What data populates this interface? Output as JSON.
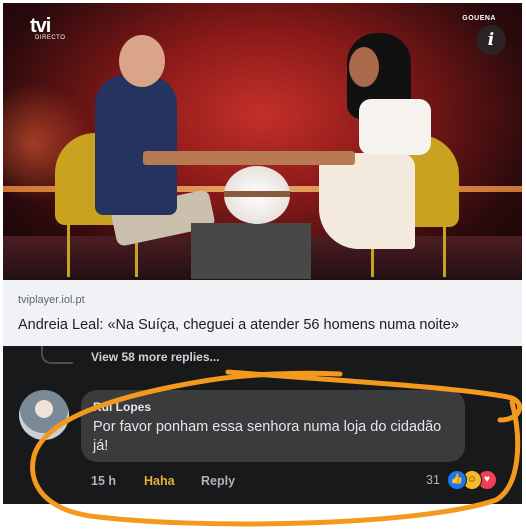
{
  "video": {
    "channel_logo": "tvi",
    "channel_logo_sub": "DIRECTO",
    "corner_label": "GOUENA",
    "info_icon": "info-icon"
  },
  "link_preview": {
    "source": "tviplayer.iol.pt",
    "headline": "Andreia Leal: «Na Suíça, cheguei a atender 56 homens numa noite»"
  },
  "comments": {
    "view_replies": "View 58 more replies...",
    "comment": {
      "author": "Rui Lopes",
      "text": "Por favor ponham essa senhora numa loja do cidadão já!",
      "time": "15 h",
      "reaction_label": "Haha",
      "reply_label": "Reply",
      "reaction_count": "31",
      "reaction_icons": [
        "like-icon",
        "haha-icon",
        "love-icon"
      ]
    }
  },
  "colors": {
    "comment_bg": "#18191a",
    "bubble_bg": "#3a3b3c",
    "haha": "#e4b13c",
    "highlight_stroke": "#f39a1e"
  }
}
